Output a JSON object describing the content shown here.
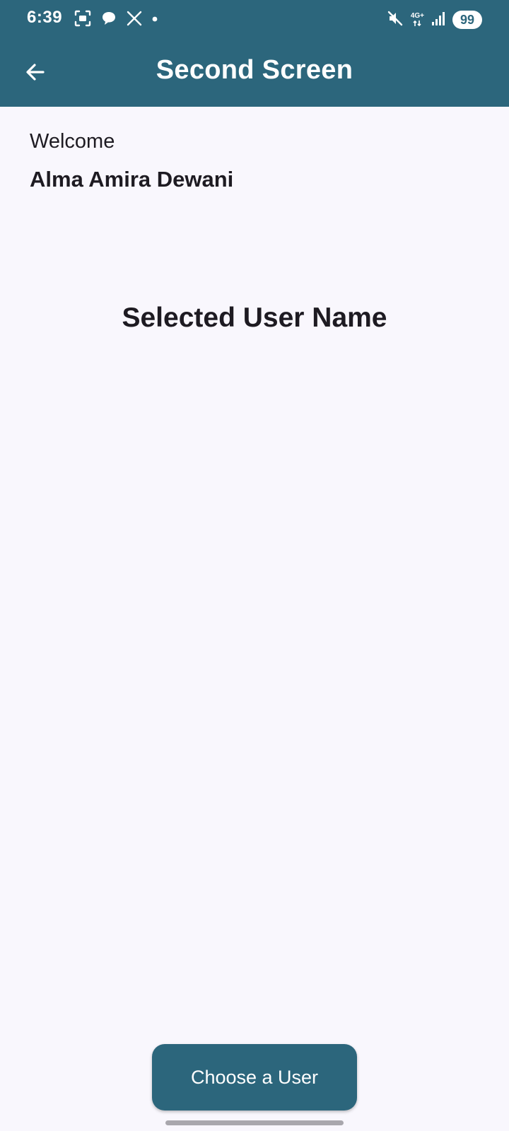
{
  "status_bar": {
    "time": "6:39",
    "network_label": "4G+",
    "battery": "99",
    "left_icons": [
      "screenshot-icon",
      "chat-bubble-icon",
      "x-logo-icon",
      "notification-dot-icon"
    ],
    "right_icons": [
      "mute-icon",
      "network-arrows-icon",
      "signal-icon",
      "battery-icon"
    ]
  },
  "app_bar": {
    "title": "Second Screen",
    "back_icon": "arrow-back-icon"
  },
  "content": {
    "welcome_label": "Welcome",
    "user_name": "Alma Amira Dewani",
    "selected_user_name": "Selected User Name"
  },
  "actions": {
    "choose_user_label": "Choose a User"
  },
  "colors": {
    "primary": "#2c667c",
    "background": "#f9f7fd",
    "text": "#1e1b22",
    "on_primary": "#ffffff"
  }
}
